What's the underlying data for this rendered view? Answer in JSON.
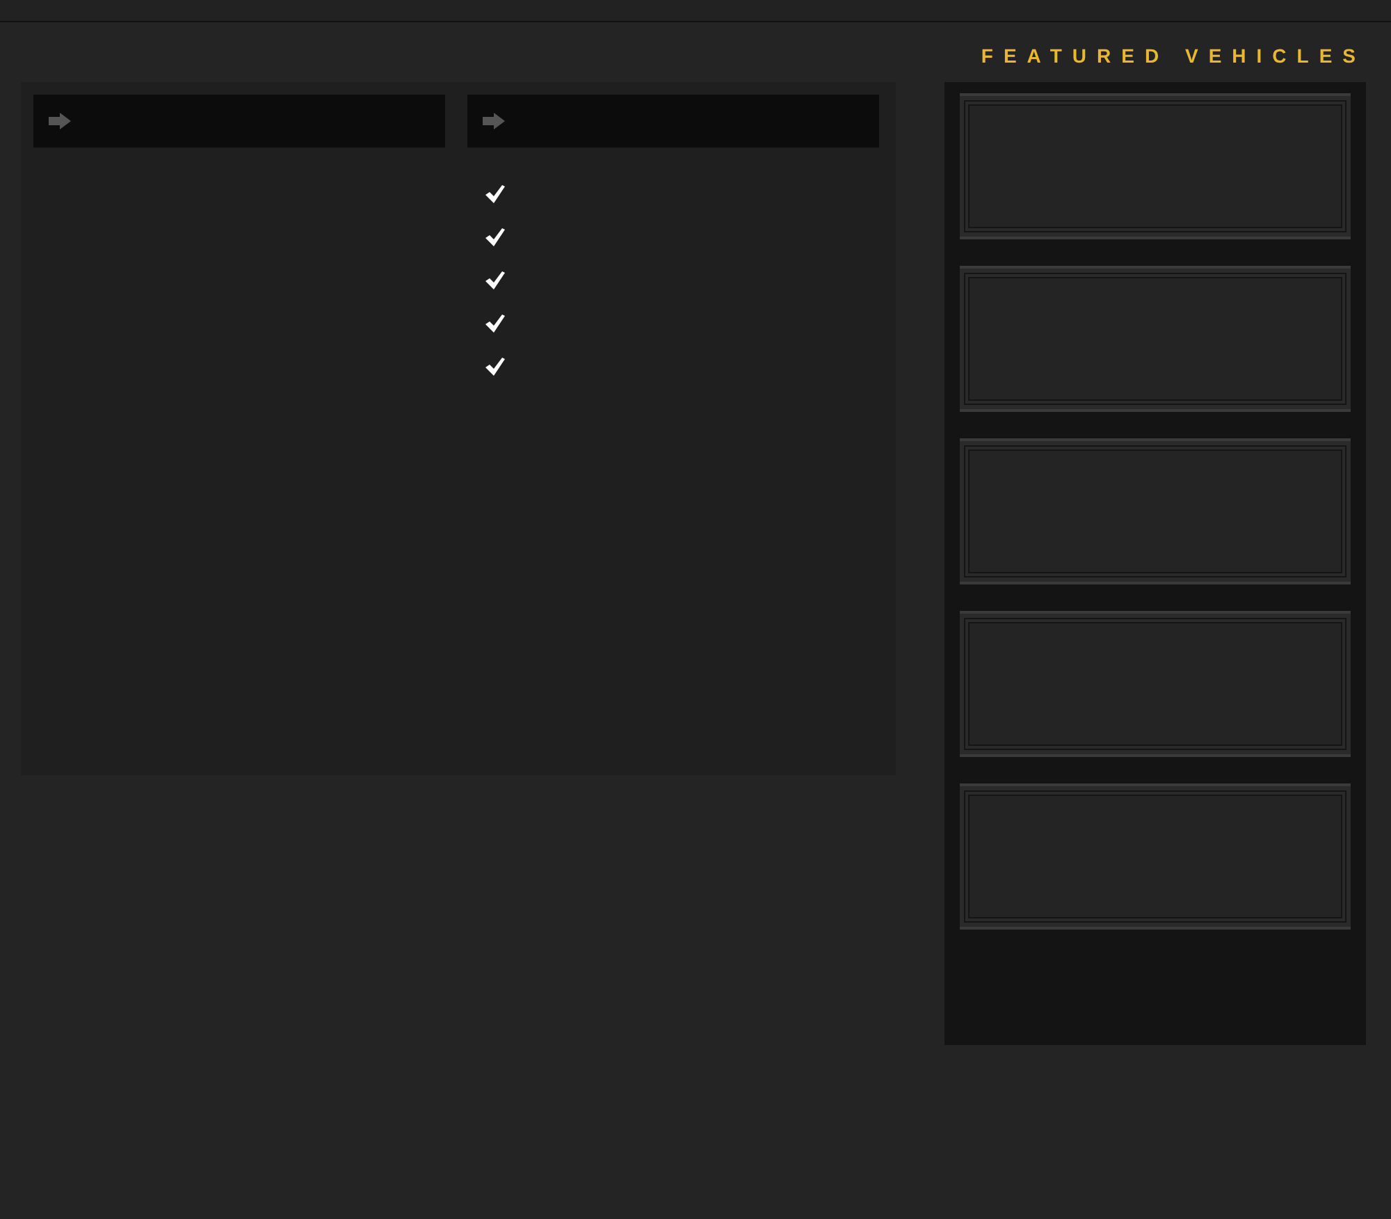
{
  "sidebar": {
    "title": "FEATURED VEHICLES"
  }
}
